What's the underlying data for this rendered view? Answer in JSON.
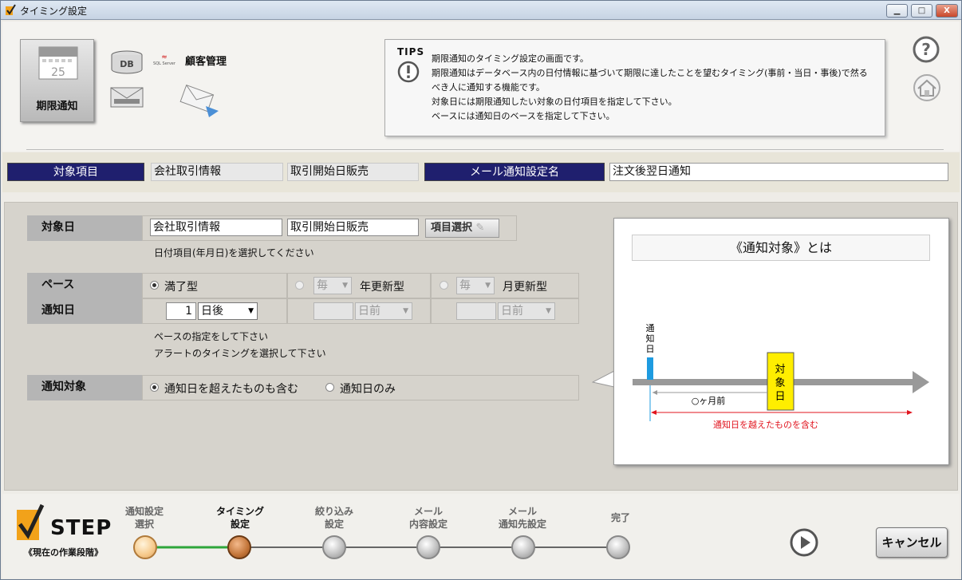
{
  "window": {
    "title": "タイミング設定",
    "btn_min": "▁",
    "btn_max": "□",
    "btn_close": "X"
  },
  "header": {
    "tab_label": "期限通知",
    "calendar_day": "25",
    "db_label": "DB",
    "sql_logo": "SQL Server",
    "customer_label": "顧客管理",
    "tips": {
      "label": "TIPS",
      "icon": "exclamation-icon",
      "lines": [
        "期限通知のタイミング設定の画面です。",
        "期限通知はデータベース内の日付情報に基づいて期限に達したことを望むタイミング(事前・当日・事後)で然るべき人に通知する機能です。",
        "対象日には期限通知したい対象の日付項目を指定して下さい。",
        "ベースには通知日のベースを指定して下さい。"
      ]
    }
  },
  "infobar": {
    "target_item_label": "対象項目",
    "target_table": "会社取引情報",
    "target_field": "取引開始日販売",
    "mail_setting_label": "メール通知設定名",
    "mail_setting_value": "注文後翌日通知"
  },
  "form": {
    "target_date": {
      "label": "対象日",
      "table": "会社取引情報",
      "field": "取引開始日販売",
      "select_button": "項目選択",
      "note": "日付項目(年月日)を選択してください"
    },
    "base": {
      "label": "ペース",
      "opt1": "満了型",
      "opt2_combo": "毎",
      "opt2_label": "年更新型",
      "opt3_combo": "毎",
      "opt3_label": "月更新型"
    },
    "notify_day": {
      "label": "通知日",
      "value": "1",
      "unit": "日後",
      "unit2": "日前",
      "unit3": "日前",
      "note1": "ペースの指定をして下さい",
      "note2": "アラートのタイミングを選択して下さい"
    },
    "notify_target": {
      "label": "通知対象",
      "opt1": "通知日を超えたものも含む",
      "opt2": "通知日のみ"
    }
  },
  "diagram": {
    "title": "《通知対象》とは",
    "notify_label": "通知日",
    "target_label": "対象日",
    "months_label": "○ヶ月前",
    "include_label": "通知日を越えたものを含む",
    "colors": {
      "bar": "#1e9be0",
      "box": "#ffee00",
      "arrow": "#e1141e",
      "axis": "#999999"
    }
  },
  "steps": {
    "logo": "STEP",
    "sub": "《現在の作業段階》",
    "items": [
      {
        "label": "通知設定\n選択",
        "state": "done"
      },
      {
        "label": "タイミング\n設定",
        "state": "current"
      },
      {
        "label": "絞り込み\n設定",
        "state": "todo"
      },
      {
        "label": "メール\n内容設定",
        "state": "todo"
      },
      {
        "label": "メール\n通知先設定",
        "state": "todo"
      },
      {
        "label": "完了",
        "state": "todo"
      }
    ],
    "cancel": "キャンセル"
  }
}
